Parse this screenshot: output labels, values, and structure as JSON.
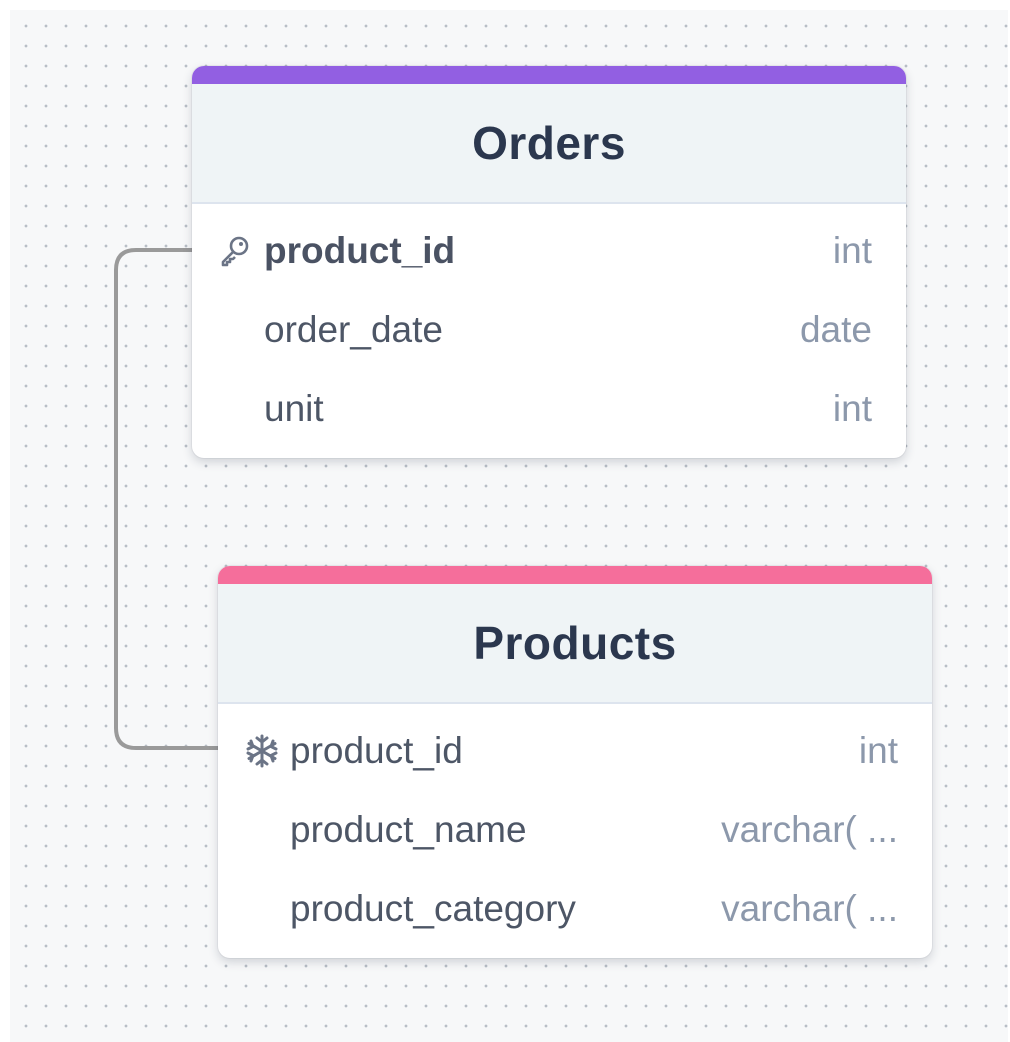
{
  "colors": {
    "orders_accent": "#925fe2",
    "products_accent": "#f56e9b",
    "connector": "#9a9a9a",
    "canvas_dot": "#b8bec6"
  },
  "tables": {
    "orders": {
      "name": "Orders",
      "rows": [
        {
          "name": "product_id",
          "type": "int",
          "icon": "key-icon",
          "primary_key": true
        },
        {
          "name": "order_date",
          "type": "date"
        },
        {
          "name": "unit",
          "type": "int"
        }
      ]
    },
    "products": {
      "name": "Products",
      "rows": [
        {
          "name": "product_id",
          "type": "int",
          "icon": "snowflake-icon"
        },
        {
          "name": "product_name",
          "type": "varchar( ..."
        },
        {
          "name": "product_category",
          "type": "varchar( ..."
        }
      ]
    }
  },
  "relationships": [
    {
      "from": "Orders.product_id",
      "to": "Products.product_id"
    }
  ]
}
